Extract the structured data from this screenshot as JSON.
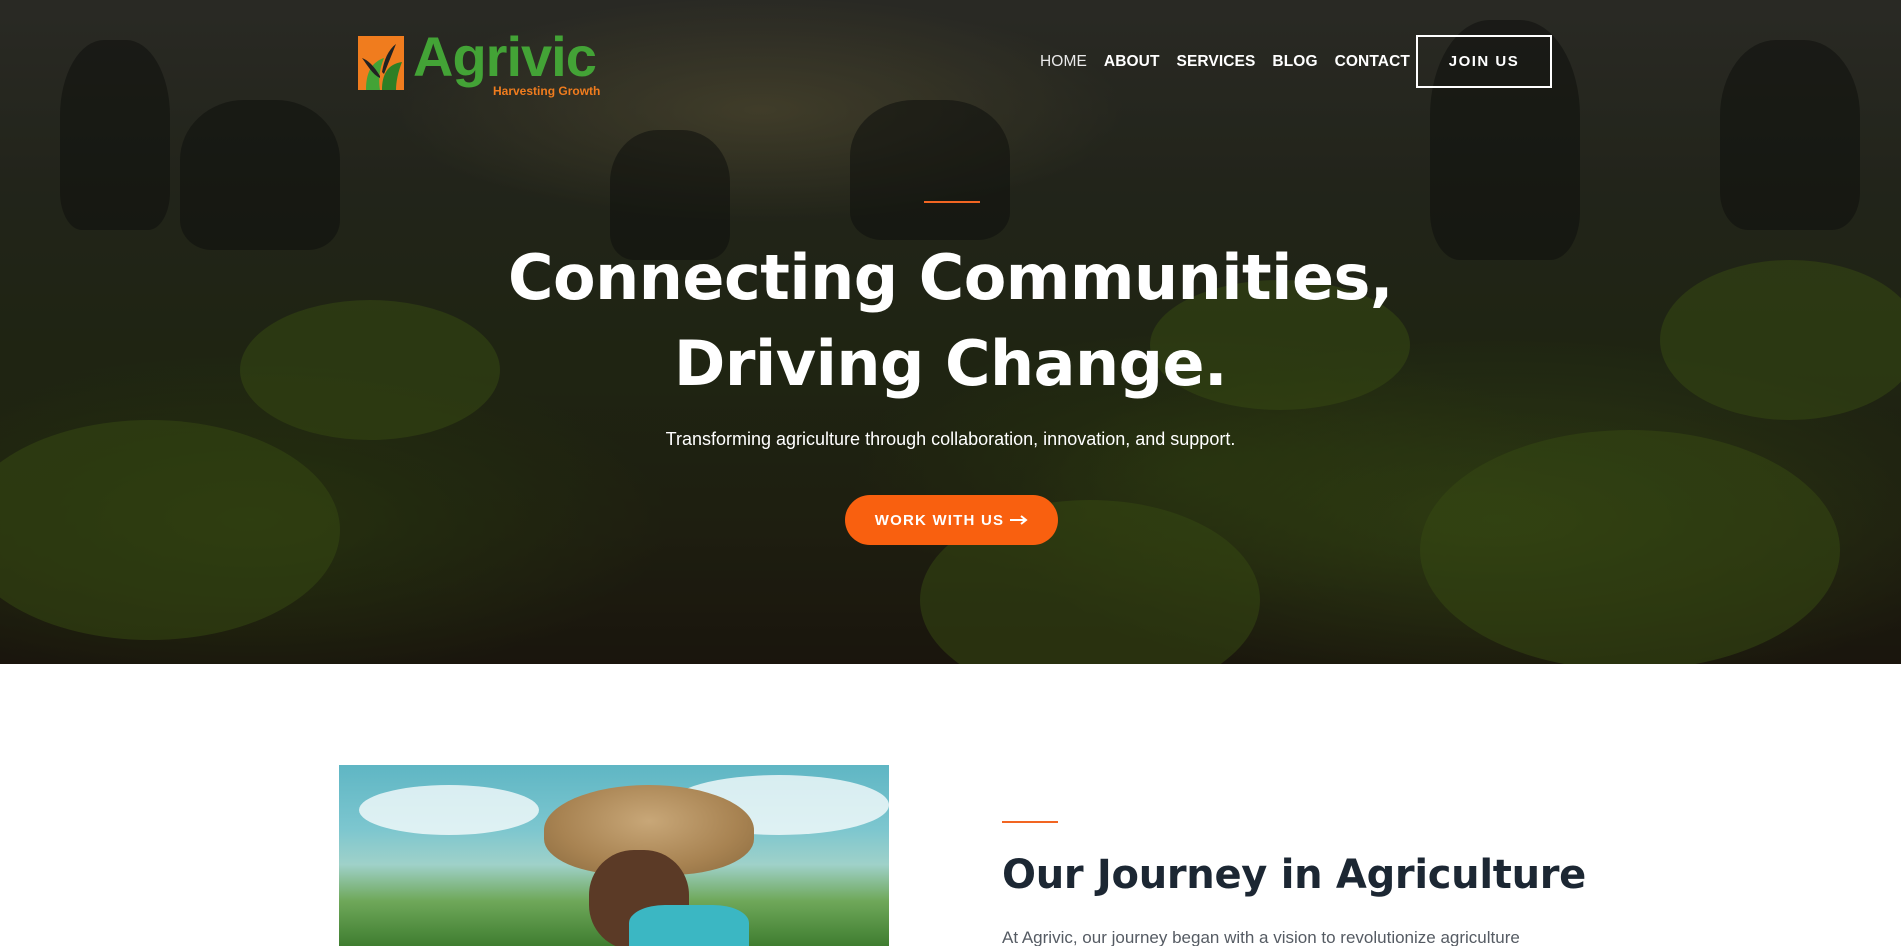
{
  "brand": {
    "name": "Agrivic",
    "tagline": "Harvesting Growth",
    "colors": {
      "green": "#43a336",
      "orange": "#f07c1e"
    }
  },
  "nav": {
    "items": [
      {
        "label": "HOME",
        "active": true
      },
      {
        "label": "ABOUT"
      },
      {
        "label": "SERVICES"
      },
      {
        "label": "BLOG"
      },
      {
        "label": "CONTACT"
      }
    ],
    "cta_label": "JOIN US"
  },
  "hero": {
    "title": "Connecting Communities, Driving Change.",
    "subtitle": "Transforming agriculture through collaboration, innovation, and support.",
    "cta_label": "WORK WITH US",
    "cta_icon": "arrow-right-icon",
    "accent_color": "#f26522",
    "button_color": "#f9600f"
  },
  "about": {
    "title": "Our Journey in Agriculture",
    "text": "At Agrivic, our journey began with a vision to revolutionize agriculture"
  }
}
